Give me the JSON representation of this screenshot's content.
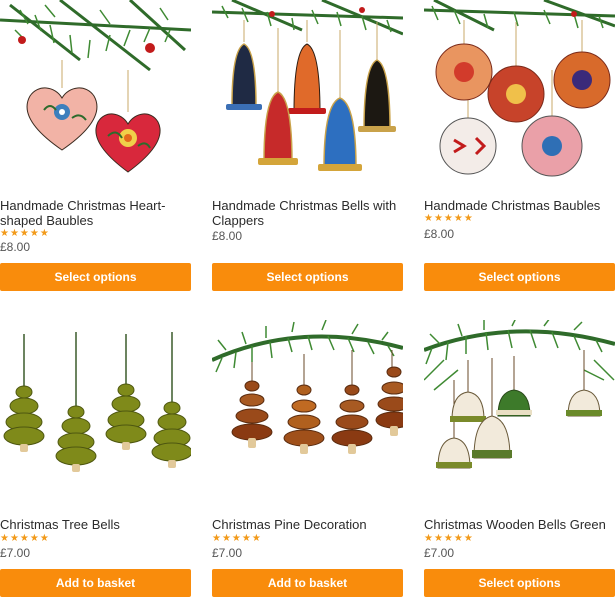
{
  "products": [
    {
      "title": "Handmade Christmas Heart-shaped Baubles",
      "rating_stars": "★★★★★",
      "price": "£8.00",
      "button": "Select options"
    },
    {
      "title": "Handmade Christmas Bells with Clappers",
      "rating_stars": "★★★★★",
      "price": "£8.00",
      "button": "Select options"
    },
    {
      "title": "Handmade Christmas Baubles",
      "rating_stars": "★★★★★",
      "price": "£8.00",
      "button": "Select options"
    },
    {
      "title": "Christmas Tree Bells",
      "rating_stars": "★★★★★",
      "price": "£7.00",
      "button": "Add to basket"
    },
    {
      "title": "Christmas Pine Decoration",
      "rating_stars": "★★★★★",
      "price": "£7.00",
      "button": "Add to basket"
    },
    {
      "title": "Christmas Wooden Bells Green",
      "rating_stars": "★★★★★",
      "price": "£7.00",
      "button": "Select options"
    }
  ],
  "colors": {
    "button_bg": "#f98c0c",
    "star": "#f29a1a",
    "text": "#2b2b2b"
  },
  "icons": {
    "rating": "star-icon"
  }
}
